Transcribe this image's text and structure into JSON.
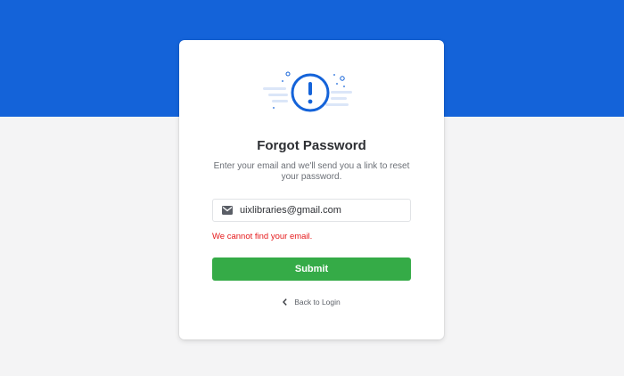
{
  "colors": {
    "brand_blue": "#1463d9",
    "submit_green": "#35ab47",
    "error_red": "#e5191b"
  },
  "icons": {
    "illustration": "exclamation-circle-icon",
    "email": "envelope-icon",
    "back": "chevron-left-icon"
  },
  "card": {
    "title": "Forgot Password",
    "subtitle": "Enter your email and we'll send you a link to reset your password.",
    "email_value": "uixlibraries@gmail.com",
    "error_message": "We cannot find your email.",
    "submit_label": "Submit",
    "back_label": "Back to Login"
  }
}
